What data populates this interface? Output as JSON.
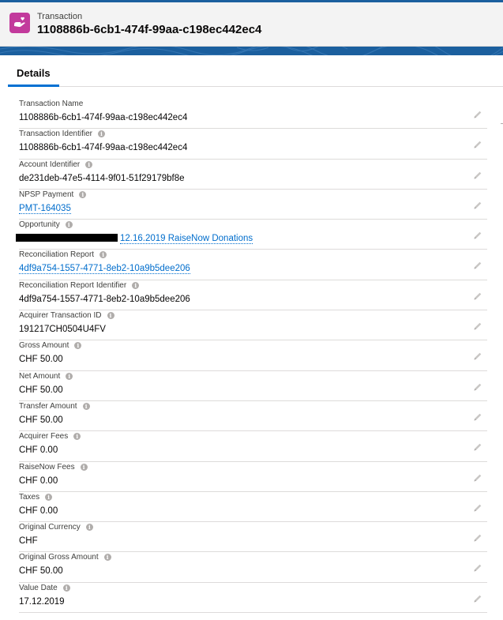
{
  "header": {
    "record_type": "Transaction",
    "record_title": "1108886b-6cb1-474f-99aa-c198ec442ec4",
    "icon": "hand-heart-icon"
  },
  "tabs": [
    {
      "label": "Details",
      "active": true
    }
  ],
  "fields": [
    {
      "label": "Transaction Name",
      "value": "1108886b-6cb1-474f-99aa-c198ec442ec4",
      "info": false,
      "link": false
    },
    {
      "label": "Transaction Identifier",
      "value": "1108886b-6cb1-474f-99aa-c198ec442ec4",
      "info": true,
      "link": false
    },
    {
      "label": "Account Identifier",
      "value": "de231deb-47e5-4114-9f01-51f29179bf8e",
      "info": true,
      "link": false
    },
    {
      "label": "NPSP Payment",
      "value": "PMT-164035",
      "info": true,
      "link": true
    },
    {
      "label": "Opportunity",
      "value": "12.16.2019 RaiseNow Donations",
      "info": true,
      "link": true,
      "redacted_prefix": true
    },
    {
      "label": "Reconciliation Report",
      "value": "4df9a754-1557-4771-8eb2-10a9b5dee206",
      "info": true,
      "link": true
    },
    {
      "label": "Reconciliation Report Identifier",
      "value": "4df9a754-1557-4771-8eb2-10a9b5dee206",
      "info": true,
      "link": false
    },
    {
      "label": "Acquirer Transaction ID",
      "value": "191217CH0504U4FV",
      "info": true,
      "link": false
    },
    {
      "label": "Gross Amount",
      "value": "CHF 50.00",
      "info": true,
      "link": false
    },
    {
      "label": "Net Amount",
      "value": "CHF 50.00",
      "info": true,
      "link": false
    },
    {
      "label": "Transfer Amount",
      "value": "CHF 50.00",
      "info": true,
      "link": false
    },
    {
      "label": "Acquirer Fees",
      "value": "CHF 0.00",
      "info": true,
      "link": false
    },
    {
      "label": "RaiseNow Fees",
      "value": "CHF 0.00",
      "info": true,
      "link": false
    },
    {
      "label": "Taxes",
      "value": "CHF 0.00",
      "info": true,
      "link": false
    },
    {
      "label": "Original Currency",
      "value": "CHF",
      "info": true,
      "link": false
    },
    {
      "label": "Original Gross Amount",
      "value": "CHF 50.00",
      "info": true,
      "link": false
    },
    {
      "label": "Value Date",
      "value": "17.12.2019",
      "info": true,
      "link": false
    }
  ],
  "colors": {
    "brand_blue": "#1b5f9e",
    "record_icon": "#c23a9c",
    "link": "#006dcc",
    "tab_underline": "#0070d2"
  }
}
